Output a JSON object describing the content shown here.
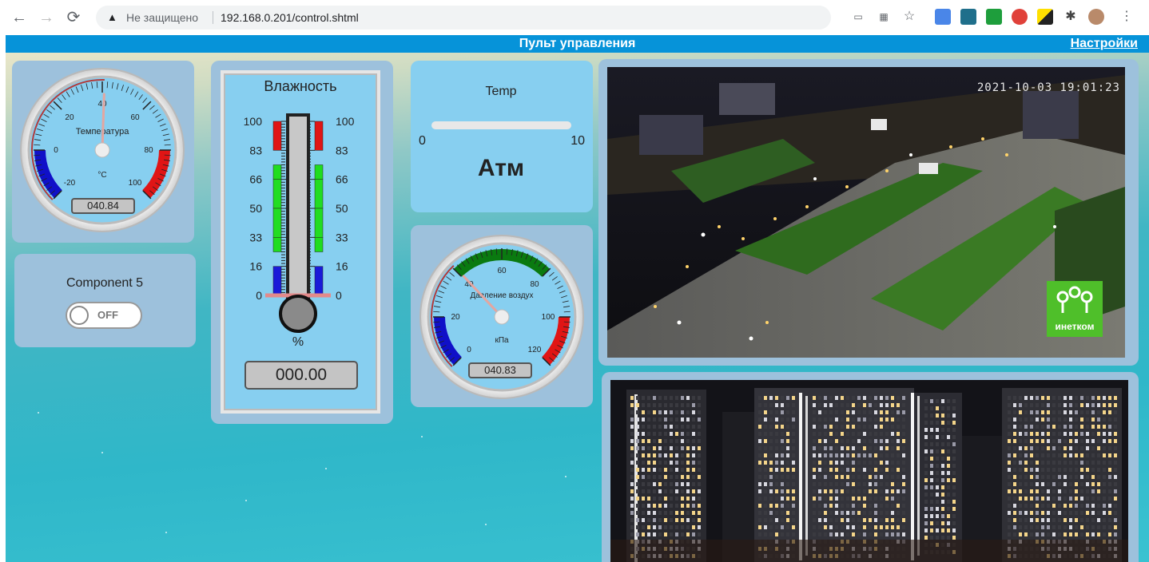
{
  "browser": {
    "security_label": "Не защищено",
    "url": "192.168.0.201/control.shtml"
  },
  "header": {
    "title": "Пульт управления",
    "settings_link": "Настройки"
  },
  "temperature_gauge": {
    "title": "Температура",
    "unit": "°C",
    "ticks": [
      "-20",
      "0",
      "20",
      "40",
      "60",
      "80",
      "100"
    ],
    "value_text": "040.84",
    "value": 40.84,
    "min": -20,
    "max": 100
  },
  "component5": {
    "label": "Component 5",
    "state_text": "OFF"
  },
  "humidity": {
    "title": "Влажность",
    "unit": "%",
    "ticks": [
      "100",
      "83",
      "66",
      "50",
      "33",
      "16",
      "0"
    ],
    "value_text": "000.00"
  },
  "temp_slider": {
    "title": "Temp",
    "min_label": "0",
    "max_label": "10",
    "unit_label": "Атм"
  },
  "pressure_gauge": {
    "title": "Давление воздух",
    "unit": "кПа",
    "ticks": [
      "0",
      "20",
      "40",
      "60",
      "80",
      "100",
      "120"
    ],
    "value_text": "040.83",
    "value": 40.83,
    "min": 0,
    "max": 120
  },
  "camera1": {
    "timestamp": "2021-10-03 19:01:23",
    "logo_text": "инетком"
  },
  "colors": {
    "header": "#0693d9",
    "panel": "#9dc1dc",
    "panel_inner": "#87cff0",
    "gauge_low": "#1010c8",
    "gauge_high": "#e01515",
    "gauge_mid": "#0a7a10"
  }
}
